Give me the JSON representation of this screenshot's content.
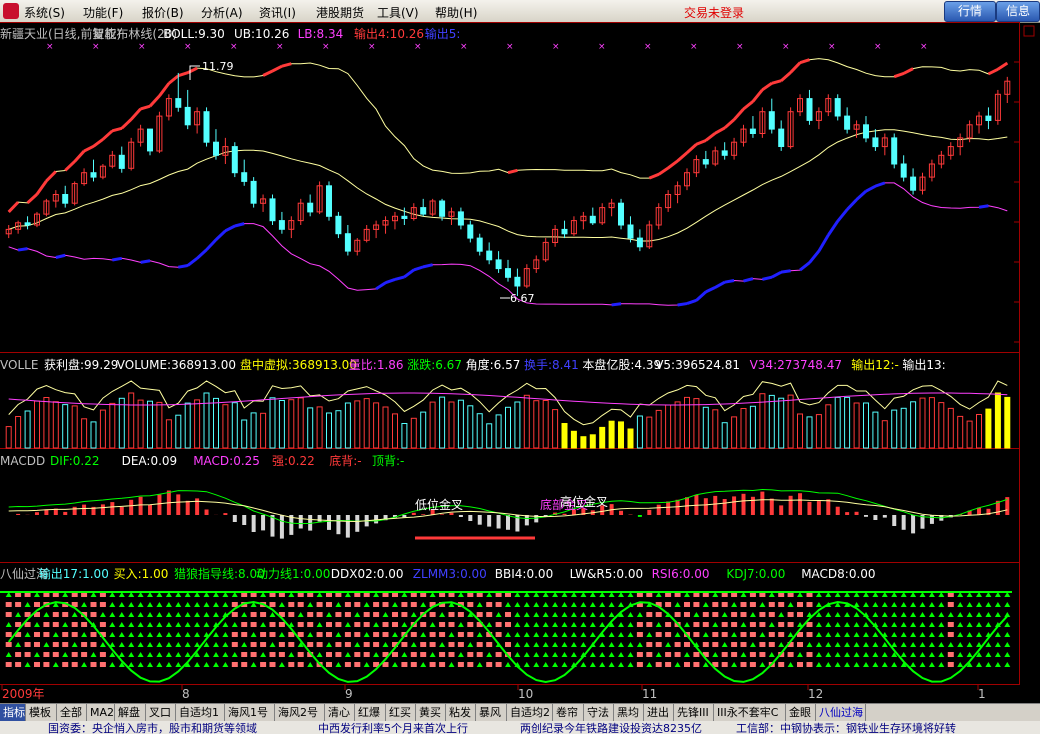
{
  "menu": {
    "items": [
      "系统(S)",
      "功能(F)",
      "报价(B)",
      "分析(A)",
      "资讯(I)",
      "港股期货",
      "工具(V)",
      "帮助(H)"
    ],
    "status": "交易未登录",
    "btn_quote": "行情",
    "btn_info": "信息"
  },
  "colors": {
    "up": "#ff3a3a",
    "down": "#54ffff",
    "ma": "#ffffa0",
    "lower": "#ff40ff",
    "blue": "#2020ff",
    "green": "#00ff00",
    "yellow": "#ffff00",
    "grid": "#800000"
  },
  "main_legend": [
    {
      "text": "新疆天业(日线,前复权)",
      "color": "#c0c0c0"
    },
    {
      "text": "智能布林线(20)",
      "color": "#c0c0c0"
    },
    {
      "text": "BOLL:9.30",
      "color": "#ffffff"
    },
    {
      "text": "UB:10.26",
      "color": "#ffffff"
    },
    {
      "text": "LB:8.34",
      "color": "#ff40ff"
    },
    {
      "text": "输出4:10.26",
      "color": "#ff3a3a"
    },
    {
      "text": "输出5:",
      "color": "#4040ff"
    }
  ],
  "annot_high": "11.79",
  "annot_low": "6.67",
  "vol_legend": [
    {
      "text": "VOLLE",
      "color": "#c0c0c0"
    },
    {
      "text": "获利盘:99.29",
      "color": "#ffffff"
    },
    {
      "text": "VOLUME:368913.00",
      "color": "#ffffff"
    },
    {
      "text": "盘中虚拟:368913.00",
      "color": "#ffff00"
    },
    {
      "text": "量比:1.86",
      "color": "#ff40ff"
    },
    {
      "text": "涨跌:6.67",
      "color": "#00ff00"
    },
    {
      "text": "角度:6.57",
      "color": "#ffffff"
    },
    {
      "text": "换手:8.41",
      "color": "#4040ff"
    },
    {
      "text": "本盘亿股:4.39",
      "color": "#ffffff"
    },
    {
      "text": "V5:396524.81",
      "color": "#ffffff"
    },
    {
      "text": "V34:273748.47",
      "color": "#ff40ff"
    },
    {
      "text": "输出12:-",
      "color": "#ffff00"
    },
    {
      "text": "输出13:",
      "color": "#ffffff"
    }
  ],
  "macd_legend": [
    {
      "text": "MACDD",
      "color": "#c0c0c0"
    },
    {
      "text": "DIF:0.22",
      "color": "#00ff00"
    },
    {
      "text": "DEA:0.09",
      "color": "#ffffff"
    },
    {
      "text": "MACD:0.25",
      "color": "#ff40ff"
    },
    {
      "text": "强:0.22",
      "color": "#ff3a3a"
    },
    {
      "text": "底背:-",
      "color": "#ff3a3a"
    },
    {
      "text": "顶背:-",
      "color": "#00ff00"
    }
  ],
  "macd_annot": [
    "低位金叉",
    "底部金叉",
    "高位金叉"
  ],
  "bx_legend": [
    {
      "text": "八仙过海",
      "color": "#c0c0c0"
    },
    {
      "text": "输出17:1.00",
      "color": "#54ffff"
    },
    {
      "text": "买入:1.00",
      "color": "#ffff00"
    },
    {
      "text": "猎狼指导线:8.00",
      "color": "#00ff00"
    },
    {
      "text": "动力线1:0.00",
      "color": "#00ff00"
    },
    {
      "text": "DDX02:0.00",
      "color": "#ffffff"
    },
    {
      "text": "ZLMM3:0.00",
      "color": "#4040ff"
    },
    {
      "text": "BBI4:0.00",
      "color": "#ffffff"
    },
    {
      "text": "LW&R5:0.00",
      "color": "#ffffff"
    },
    {
      "text": "RSI6:0.00",
      "color": "#ff40ff"
    },
    {
      "text": "KDJ7:0.00",
      "color": "#00ff00"
    },
    {
      "text": "MACD8:0.00",
      "color": "#ffffff"
    }
  ],
  "time_axis": [
    {
      "label": "2009年",
      "color": "#ff3a3a"
    },
    {
      "label": "8",
      "color": "#c0c0c0"
    },
    {
      "label": "9",
      "color": "#c0c0c0"
    },
    {
      "label": "10",
      "color": "#c0c0c0"
    },
    {
      "label": "11",
      "color": "#c0c0c0"
    },
    {
      "label": "12",
      "color": "#c0c0c0"
    },
    {
      "label": "1",
      "color": "#c0c0c0"
    }
  ],
  "tabs": [
    "指标",
    "模板",
    "全部",
    "MA2",
    "解盘",
    "叉口",
    "自适均1",
    "海风1号",
    "海风2号",
    "清心",
    "红爆",
    "红买",
    "黄买",
    "粘发",
    "暴风",
    "自适均2",
    "卷帘",
    "守法",
    "黑均",
    "进出",
    "先锋III",
    "III永不套牢C",
    "金眼",
    "八仙过海"
  ],
  "ticker": [
    "国资委：央企悄入房市，股市和期货等领域",
    "中西发行利率5个月来首次上行",
    "两创纪录今年铁路建设投资达8235亿",
    "工信部：中钢协表示：钢铁业生存环境将好转"
  ],
  "chart_data": {
    "type": "candlestick",
    "candles": [
      [
        8.1,
        8.3,
        8.0,
        8.2
      ],
      [
        8.2,
        8.4,
        8.1,
        8.35
      ],
      [
        8.35,
        8.5,
        8.2,
        8.3
      ],
      [
        8.3,
        8.6,
        8.25,
        8.55
      ],
      [
        8.55,
        8.9,
        8.5,
        8.85
      ],
      [
        8.85,
        9.1,
        8.7,
        9.0
      ],
      [
        9.0,
        9.2,
        8.7,
        8.8
      ],
      [
        8.8,
        9.3,
        8.75,
        9.25
      ],
      [
        9.25,
        9.6,
        9.2,
        9.5
      ],
      [
        9.5,
        9.8,
        9.3,
        9.4
      ],
      [
        9.4,
        9.7,
        9.35,
        9.65
      ],
      [
        9.65,
        10.0,
        9.6,
        9.9
      ],
      [
        9.9,
        10.1,
        9.5,
        9.6
      ],
      [
        9.6,
        10.3,
        9.55,
        10.2
      ],
      [
        10.2,
        10.6,
        10.1,
        10.5
      ],
      [
        10.5,
        10.4,
        9.9,
        10.0
      ],
      [
        10.0,
        10.9,
        9.95,
        10.8
      ],
      [
        10.8,
        11.3,
        10.7,
        11.2
      ],
      [
        11.2,
        11.79,
        10.9,
        11.0
      ],
      [
        11.0,
        11.4,
        10.5,
        10.6
      ],
      [
        10.6,
        11.0,
        10.4,
        10.9
      ],
      [
        10.9,
        11.0,
        10.1,
        10.2
      ],
      [
        10.2,
        10.5,
        9.8,
        9.9
      ],
      [
        9.9,
        10.3,
        9.7,
        10.1
      ],
      [
        10.1,
        10.2,
        9.4,
        9.5
      ],
      [
        9.5,
        9.8,
        9.2,
        9.3
      ],
      [
        9.3,
        9.4,
        8.7,
        8.8
      ],
      [
        8.8,
        9.0,
        8.6,
        8.9
      ],
      [
        8.9,
        9.0,
        8.3,
        8.4
      ],
      [
        8.4,
        8.6,
        8.1,
        8.2
      ],
      [
        8.2,
        8.5,
        8.0,
        8.4
      ],
      [
        8.4,
        8.9,
        8.3,
        8.8
      ],
      [
        8.8,
        9.0,
        8.5,
        8.6
      ],
      [
        8.6,
        9.3,
        8.55,
        9.2
      ],
      [
        9.2,
        9.3,
        8.4,
        8.5
      ],
      [
        8.5,
        8.6,
        8.0,
        8.1
      ],
      [
        8.1,
        8.3,
        7.6,
        7.7
      ],
      [
        7.7,
        8.0,
        7.6,
        7.95
      ],
      [
        7.95,
        8.3,
        7.9,
        8.2
      ],
      [
        8.2,
        8.4,
        8.0,
        8.3
      ],
      [
        8.3,
        8.5,
        8.1,
        8.4
      ],
      [
        8.4,
        8.6,
        8.2,
        8.5
      ],
      [
        8.5,
        8.7,
        8.3,
        8.45
      ],
      [
        8.45,
        8.8,
        8.4,
        8.7
      ],
      [
        8.7,
        8.9,
        8.5,
        8.55
      ],
      [
        8.55,
        8.9,
        8.5,
        8.85
      ],
      [
        8.85,
        8.9,
        8.4,
        8.5
      ],
      [
        8.5,
        8.7,
        8.3,
        8.6
      ],
      [
        8.6,
        8.7,
        8.2,
        8.3
      ],
      [
        8.3,
        8.4,
        7.9,
        8.0
      ],
      [
        8.0,
        8.1,
        7.6,
        7.7
      ],
      [
        7.7,
        7.9,
        7.4,
        7.5
      ],
      [
        7.5,
        7.7,
        7.2,
        7.3
      ],
      [
        7.3,
        7.5,
        7.0,
        7.1
      ],
      [
        7.1,
        7.3,
        6.67,
        6.9
      ],
      [
        6.9,
        7.4,
        6.85,
        7.3
      ],
      [
        7.3,
        7.6,
        7.2,
        7.5
      ],
      [
        7.5,
        8.0,
        7.45,
        7.9
      ],
      [
        7.9,
        8.3,
        7.8,
        8.2
      ],
      [
        8.2,
        8.4,
        8.0,
        8.1
      ],
      [
        8.1,
        8.5,
        8.05,
        8.4
      ],
      [
        8.4,
        8.6,
        8.2,
        8.5
      ],
      [
        8.5,
        8.7,
        8.3,
        8.35
      ],
      [
        8.35,
        8.8,
        8.3,
        8.7
      ],
      [
        8.7,
        8.9,
        8.5,
        8.8
      ],
      [
        8.8,
        8.9,
        8.2,
        8.3
      ],
      [
        8.3,
        8.5,
        7.9,
        8.0
      ],
      [
        8.0,
        8.2,
        7.7,
        7.8
      ],
      [
        7.8,
        8.4,
        7.75,
        8.3
      ],
      [
        8.3,
        8.8,
        8.2,
        8.7
      ],
      [
        8.7,
        9.1,
        8.6,
        9.0
      ],
      [
        9.0,
        9.3,
        8.8,
        9.2
      ],
      [
        9.2,
        9.6,
        9.1,
        9.5
      ],
      [
        9.5,
        9.9,
        9.4,
        9.8
      ],
      [
        9.8,
        10.0,
        9.6,
        9.7
      ],
      [
        9.7,
        10.1,
        9.65,
        10.0
      ],
      [
        10.0,
        10.2,
        9.8,
        9.9
      ],
      [
        9.9,
        10.3,
        9.8,
        10.2
      ],
      [
        10.2,
        10.6,
        10.1,
        10.5
      ],
      [
        10.5,
        10.8,
        10.3,
        10.4
      ],
      [
        10.4,
        11.0,
        10.3,
        10.9
      ],
      [
        10.9,
        11.2,
        10.4,
        10.5
      ],
      [
        10.5,
        10.7,
        10.0,
        10.1
      ],
      [
        10.1,
        11.0,
        10.05,
        10.9
      ],
      [
        10.9,
        11.3,
        10.8,
        11.2
      ],
      [
        11.2,
        11.4,
        10.6,
        10.7
      ],
      [
        10.7,
        11.0,
        10.5,
        10.9
      ],
      [
        10.9,
        11.3,
        10.8,
        11.2
      ],
      [
        11.2,
        11.3,
        10.7,
        10.8
      ],
      [
        10.8,
        11.0,
        10.4,
        10.5
      ],
      [
        10.5,
        10.7,
        10.3,
        10.6
      ],
      [
        10.6,
        10.8,
        10.2,
        10.3
      ],
      [
        10.3,
        10.5,
        10.0,
        10.1
      ],
      [
        10.1,
        10.4,
        9.9,
        10.3
      ],
      [
        10.3,
        10.4,
        9.6,
        9.7
      ],
      [
        9.7,
        9.9,
        9.3,
        9.4
      ],
      [
        9.4,
        9.6,
        9.0,
        9.1
      ],
      [
        9.1,
        9.5,
        9.0,
        9.4
      ],
      [
        9.4,
        9.8,
        9.3,
        9.7
      ],
      [
        9.7,
        10.0,
        9.6,
        9.9
      ],
      [
        9.9,
        10.2,
        9.8,
        10.1
      ],
      [
        10.1,
        10.4,
        9.9,
        10.3
      ],
      [
        10.3,
        10.7,
        10.2,
        10.6
      ],
      [
        10.6,
        10.9,
        10.4,
        10.8
      ],
      [
        10.8,
        11.0,
        10.5,
        10.7
      ],
      [
        10.7,
        11.4,
        10.6,
        11.3
      ],
      [
        11.3,
        11.7,
        11.1,
        11.6
      ]
    ],
    "ub_range": [
      9.5,
      12.6
    ],
    "mid_range": [
      8.2,
      10.8
    ],
    "lb_range": [
      6.0,
      9.4
    ],
    "ylim": [
      5.5,
      12.5
    ]
  }
}
